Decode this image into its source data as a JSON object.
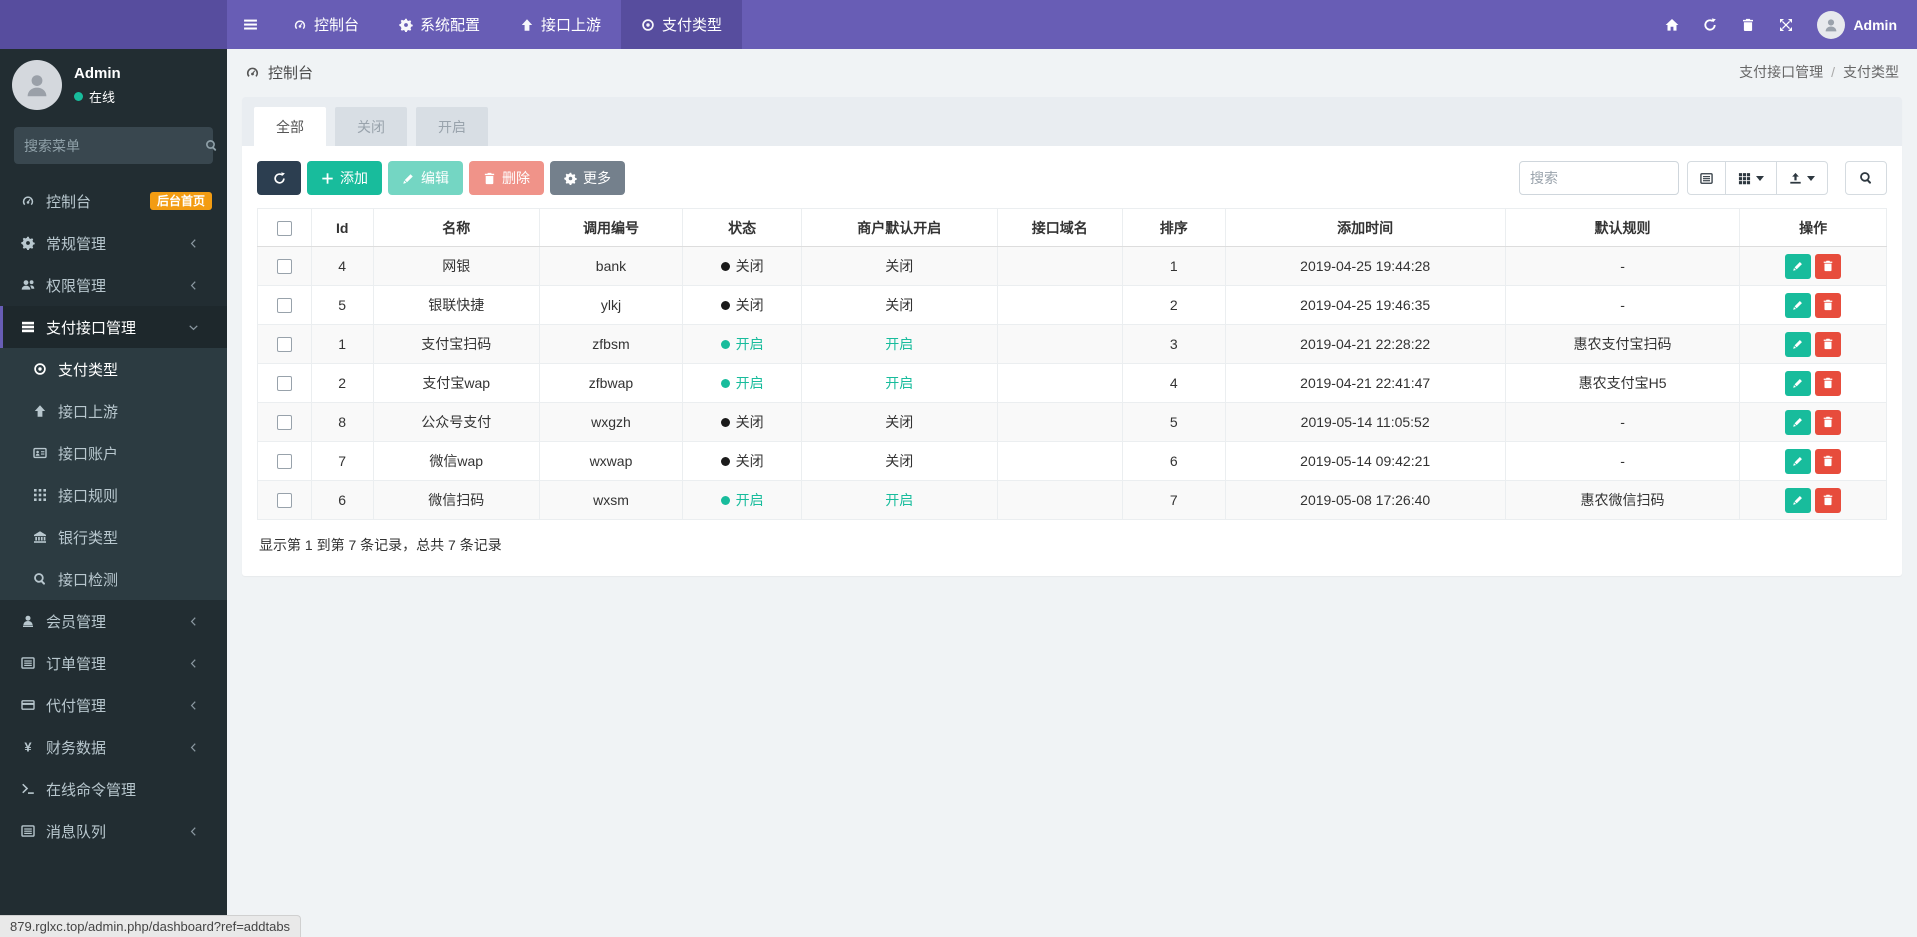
{
  "colors": {
    "navbar_purple": "#685DB5",
    "navbar_active_purple": "#574D9E",
    "sidebar_bg": "#222D32",
    "sidebar_submenu_bg": "#2C3B41",
    "success_green": "#18BC9C",
    "danger_red": "#E74C3C",
    "badge_orange": "#F39C12",
    "dark_button": "#2C3E50",
    "gray_button": "#74808C",
    "page_bg": "#F0F3F5"
  },
  "navbar": {
    "items": [
      {
        "label": "控制台",
        "icon": "gauge",
        "active": false
      },
      {
        "label": "系统配置",
        "icon": "gear",
        "active": false
      },
      {
        "label": "接口上游",
        "icon": "arrow-up",
        "active": false
      },
      {
        "label": "支付类型",
        "icon": "pay-logo",
        "active": true
      }
    ],
    "right_icons": [
      "home",
      "refresh",
      "trash",
      "expand"
    ],
    "user_name": "Admin"
  },
  "sidebar": {
    "user": {
      "name": "Admin",
      "status": "在线"
    },
    "search_placeholder": "搜索菜单",
    "items": [
      {
        "label": "控制台",
        "icon": "gauge",
        "badge": "后台首页"
      },
      {
        "label": "常规管理",
        "icon": "gear",
        "arrow": "left"
      },
      {
        "label": "权限管理",
        "icon": "users",
        "arrow": "left"
      },
      {
        "label": "支付接口管理",
        "icon": "list",
        "arrow": "down",
        "parent_active": true
      },
      {
        "label": "支付类型",
        "icon": "pay-logo",
        "child": true,
        "child_active": true
      },
      {
        "label": "接口上游",
        "icon": "arrow-up",
        "child": true
      },
      {
        "label": "接口账户",
        "icon": "id-card",
        "child": true
      },
      {
        "label": "接口规则",
        "icon": "grid",
        "child": true
      },
      {
        "label": "银行类型",
        "icon": "bank",
        "child": true
      },
      {
        "label": "接口检测",
        "icon": "search",
        "child": true
      },
      {
        "label": "会员管理",
        "icon": "member",
        "arrow": "left"
      },
      {
        "label": "订单管理",
        "icon": "list-alt",
        "arrow": "left"
      },
      {
        "label": "代付管理",
        "icon": "credit-card",
        "arrow": "left"
      },
      {
        "label": "财务数据",
        "icon": "yen",
        "arrow": "left"
      },
      {
        "label": "在线命令管理",
        "icon": "terminal"
      },
      {
        "label": "消息队列",
        "icon": "list-alt",
        "arrow": "left"
      }
    ]
  },
  "content_header": {
    "title": "控制台",
    "breadcrumb": [
      "支付接口管理",
      "支付类型"
    ]
  },
  "tabs": [
    {
      "label": "全部",
      "active": true
    },
    {
      "label": "关闭",
      "active": false
    },
    {
      "label": "开启",
      "active": false
    }
  ],
  "toolbar": {
    "buttons": [
      {
        "name": "refresh",
        "icon": "refresh",
        "style": "dark",
        "label": "",
        "disabled": false
      },
      {
        "name": "add",
        "icon": "plus",
        "style": "success",
        "label": "添加",
        "disabled": false
      },
      {
        "name": "edit",
        "icon": "pencil",
        "style": "success",
        "label": "编辑",
        "disabled": true
      },
      {
        "name": "delete",
        "icon": "trash",
        "style": "danger",
        "label": "删除",
        "disabled": true
      },
      {
        "name": "more",
        "icon": "gear",
        "style": "gray",
        "label": "更多",
        "disabled": false
      }
    ],
    "search_placeholder": "搜索",
    "view_buttons": [
      {
        "name": "toggle-view",
        "icon": "list-alt",
        "caret": false
      },
      {
        "name": "columns",
        "icon": "grid-lg",
        "caret": true
      },
      {
        "name": "export",
        "icon": "export",
        "caret": true
      }
    ]
  },
  "table": {
    "columns": [
      "Id",
      "名称",
      "调用编号",
      "状态",
      "商户默认开启",
      "接口域名",
      "排序",
      "添加时间",
      "默认规则",
      "操作"
    ],
    "rows": [
      {
        "id": "4",
        "name": "网银",
        "code": "bank",
        "status": "关闭",
        "open": false,
        "merchant": "关闭",
        "domain": "",
        "sort": "1",
        "time": "2019-04-25 19:44:28",
        "rule": "-"
      },
      {
        "id": "5",
        "name": "银联快捷",
        "code": "ylkj",
        "status": "关闭",
        "open": false,
        "merchant": "关闭",
        "domain": "",
        "sort": "2",
        "time": "2019-04-25 19:46:35",
        "rule": "-"
      },
      {
        "id": "1",
        "name": "支付宝扫码",
        "code": "zfbsm",
        "status": "开启",
        "open": true,
        "merchant": "开启",
        "domain": "",
        "sort": "3",
        "time": "2019-04-21 22:28:22",
        "rule": "惠农支付宝扫码"
      },
      {
        "id": "2",
        "name": "支付宝wap",
        "code": "zfbwap",
        "status": "开启",
        "open": true,
        "merchant": "开启",
        "domain": "",
        "sort": "4",
        "time": "2019-04-21 22:41:47",
        "rule": "惠农支付宝H5"
      },
      {
        "id": "8",
        "name": "公众号支付",
        "code": "wxgzh",
        "status": "关闭",
        "open": false,
        "merchant": "关闭",
        "domain": "",
        "sort": "5",
        "time": "2019-05-14 11:05:52",
        "rule": "-"
      },
      {
        "id": "7",
        "name": "微信wap",
        "code": "wxwap",
        "status": "关闭",
        "open": false,
        "merchant": "关闭",
        "domain": "",
        "sort": "6",
        "time": "2019-05-14 09:42:21",
        "rule": "-"
      },
      {
        "id": "6",
        "name": "微信扫码",
        "code": "wxsm",
        "status": "开启",
        "open": true,
        "merchant": "开启",
        "domain": "",
        "sort": "7",
        "time": "2019-05-08 17:26:40",
        "rule": "惠农微信扫码"
      }
    ],
    "footer": "显示第 1 到第 7 条记录，总共 7 条记录"
  },
  "status_bar": {
    "url": "879.rglxc.top/admin.php/dashboard?ref=addtabs"
  }
}
